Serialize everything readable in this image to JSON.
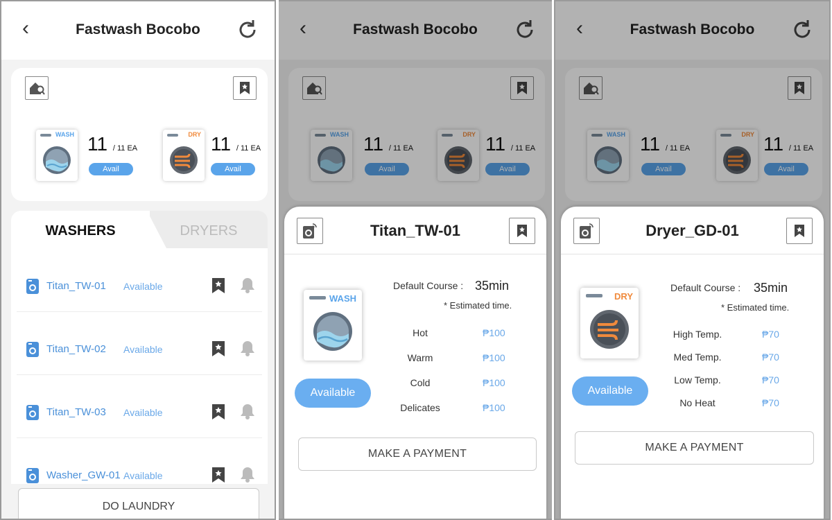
{
  "app": {
    "title": "Fastwash Bocobo"
  },
  "summary": {
    "wash": {
      "label": "WASH",
      "count": "11",
      "total": "/ 11 EA",
      "status": "Avail"
    },
    "dry": {
      "label": "DRY",
      "count": "11",
      "total": "/ 11 EA",
      "status": "Avail"
    }
  },
  "tabs": {
    "washers": "WASHERS",
    "dryers": "DRYERS"
  },
  "machines": [
    {
      "name": "Titan_TW-01",
      "status": "Available"
    },
    {
      "name": "Titan_TW-02",
      "status": "Available"
    },
    {
      "name": "Titan_TW-03",
      "status": "Available"
    },
    {
      "name": "Washer_GW-01",
      "status": "Available"
    }
  ],
  "do_laundry_label": "DO LAUNDRY",
  "washer_detail": {
    "name": "Titan_TW-01",
    "machine_label": "WASH",
    "status": "Available",
    "course_label": "Default Course :",
    "course_value": "35min",
    "estimated_note": "* Estimated time.",
    "options": [
      {
        "name": "Hot",
        "price": "₱100"
      },
      {
        "name": "Warm",
        "price": "₱100"
      },
      {
        "name": "Cold",
        "price": "₱100"
      },
      {
        "name": "Delicates",
        "price": "₱100"
      }
    ],
    "pay_label": "MAKE A PAYMENT"
  },
  "dryer_detail": {
    "name": "Dryer_GD-01",
    "machine_label": "DRY",
    "status": "Available",
    "course_label": "Default Course :",
    "course_value": "35min",
    "estimated_note": "* Estimated time.",
    "options": [
      {
        "name": "High Temp.",
        "price": "₱70"
      },
      {
        "name": "Med Temp.",
        "price": "₱70"
      },
      {
        "name": "Low Temp.",
        "price": "₱70"
      },
      {
        "name": "No Heat",
        "price": "₱70"
      }
    ],
    "pay_label": "MAKE A PAYMENT"
  },
  "colors": {
    "accent_blue": "#5aa4ea",
    "wash_label": "#5aa4ea",
    "dry_label": "#f08a3c",
    "status_text": "#6aa8e8"
  },
  "icons": [
    "back-icon",
    "refresh-icon",
    "store-search-icon",
    "bookmark-icon",
    "washer-icon",
    "dryer-icon",
    "bell-icon",
    "machine-nfc-icon"
  ]
}
